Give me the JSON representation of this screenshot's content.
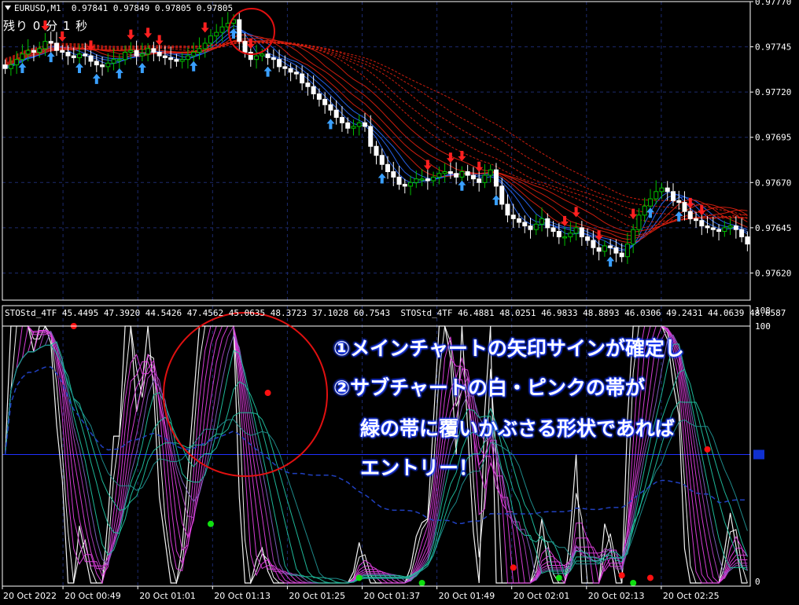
{
  "header": {
    "symbol": "EURUSD,M1",
    "ohlc": "0.97841 0.97849 0.97805 0.97805",
    "timer": "残り 0 分 1 秒"
  },
  "sub_header": {
    "indicator_1": "STOStd_4TF 45.4495 47.3920 44.5426 47.4562 45.0635 48.3723 37.1028 60.7543",
    "indicator_2": "STOStd_4TF 46.4881 48.0251 46.9833 48.8893 46.0306 49.2431 44.0639 48.6587"
  },
  "annotations": {
    "line1": "①メインチャートの矢印サインが確定し",
    "line2": "②サブチャートの白・ピンクの帯が",
    "line3": "緑の帯に覆いかぶさる形状であれば",
    "line4": "エントリー！"
  },
  "colors": {
    "grid": "#1c2a6e",
    "bull_candle": "#00c000",
    "bear_candle": "#ffffff",
    "red_ribbon": "#e02010",
    "blue_ribbon": "#2a6cff",
    "pink_band": "#e040e0",
    "green_band": "#20c0a0",
    "circle": "#e01010",
    "up_arrow": "#3aa0ff",
    "down_arrow": "#ff2020",
    "midline": "#2030ff"
  },
  "chart_data": [
    {
      "type": "candlestick",
      "name": "EURUSD,M1",
      "y_ticks": [
        "0.97770",
        "0.97745",
        "0.97720",
        "0.97695",
        "0.97670",
        "0.97645",
        "0.97620"
      ],
      "ylim": [
        0.97605,
        0.9777
      ],
      "x_ticks": [
        "20 Oct 2022",
        "20 Oct 00:49",
        "20 Oct 01:01",
        "20 Oct 01:13",
        "20 Oct 01:25",
        "20 Oct 01:37",
        "20 Oct 01:49",
        "20 Oct 02:01",
        "20 Oct 02:13",
        "20 Oct 02:25"
      ],
      "closes": [
        0.97733,
        0.97735,
        0.97738,
        0.97741,
        0.97743,
        0.97742,
        0.97744,
        0.97748,
        0.97747,
        0.97743,
        0.97742,
        0.9774,
        0.97739,
        0.97741,
        0.9774,
        0.97737,
        0.97735,
        0.97734,
        0.97736,
        0.97738,
        0.97738,
        0.97742,
        0.97743,
        0.9774,
        0.97741,
        0.97744,
        0.97742,
        0.9774,
        0.97739,
        0.97738,
        0.97737,
        0.97738,
        0.9774,
        0.97742,
        0.97744,
        0.97747,
        0.97751,
        0.97753,
        0.97756,
        0.97758,
        0.9776,
        0.97748,
        0.97742,
        0.97738,
        0.9774,
        0.97741,
        0.97739,
        0.97738,
        0.97734,
        0.97733,
        0.97731,
        0.9773,
        0.97725,
        0.97723,
        0.97719,
        0.97716,
        0.97713,
        0.9771,
        0.97706,
        0.97703,
        0.977,
        0.97701,
        0.97703,
        0.97701,
        0.9769,
        0.97685,
        0.9768,
        0.97676,
        0.97673,
        0.97669,
        0.97668,
        0.9767,
        0.97672,
        0.97672,
        0.97671,
        0.97673,
        0.97675,
        0.97676,
        0.97675,
        0.97673,
        0.97676,
        0.97674,
        0.97672,
        0.9767,
        0.97674,
        0.97677,
        0.97668,
        0.97658,
        0.97652,
        0.9765,
        0.97648,
        0.97646,
        0.97644,
        0.97647,
        0.9765,
        0.97645,
        0.97643,
        0.9764,
        0.9764,
        0.97642,
        0.97645,
        0.9764,
        0.97638,
        0.97634,
        0.97632,
        0.97635,
        0.97634,
        0.97631,
        0.97629,
        0.97636,
        0.97644,
        0.97652,
        0.97657,
        0.97661,
        0.97665,
        0.97667,
        0.97665,
        0.9766,
        0.97659,
        0.97654,
        0.9765,
        0.97649,
        0.97646,
        0.97645,
        0.97644,
        0.97643,
        0.97645,
        0.97646,
        0.97644,
        0.9764,
        0.97636
      ],
      "up_arrow_indices": [
        3,
        8,
        13,
        16,
        20,
        24,
        33,
        40,
        46,
        57,
        66,
        80,
        86,
        106,
        113,
        118
      ],
      "down_arrow_indices": [
        7,
        10,
        15,
        22,
        25,
        27,
        35,
        43,
        74,
        78,
        80,
        83,
        98,
        100,
        104,
        110,
        120,
        122
      ]
    },
    {
      "type": "line",
      "name": "STOStd_4TF",
      "ylim": [
        0,
        100
      ],
      "y_ticks": [
        "108",
        "100",
        "0"
      ],
      "midline": 50,
      "signal_dots_red": [
        {
          "i": 12,
          "v": 100
        },
        {
          "i": 46,
          "v": 74
        },
        {
          "i": 89,
          "v": 6
        },
        {
          "i": 108,
          "v": 3
        },
        {
          "i": 113,
          "v": 2
        },
        {
          "i": 123,
          "v": 52
        }
      ],
      "signal_dots_green": [
        {
          "i": 36,
          "v": 23
        },
        {
          "i": 62,
          "v": 2
        },
        {
          "i": 73,
          "v": 0
        },
        {
          "i": 97,
          "v": 2
        },
        {
          "i": 110,
          "v": 0
        }
      ]
    }
  ]
}
